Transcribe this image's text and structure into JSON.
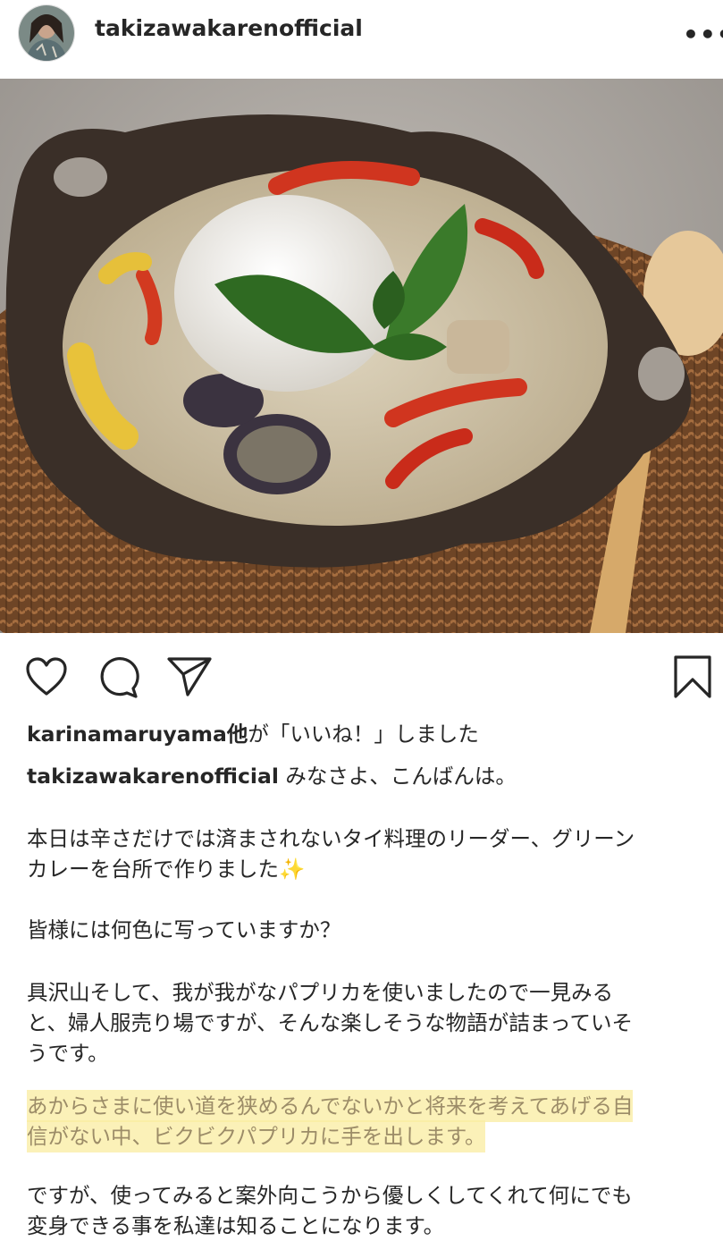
{
  "header": {
    "username": "takizawakarenofficial",
    "more_icon": "ellipsis-icon",
    "more_label": "•••"
  },
  "photo": {
    "subject": "green-curry-photo"
  },
  "actions": {
    "like_icon": "heart-icon",
    "comment_icon": "comment-icon",
    "share_icon": "send-icon",
    "save_icon": "bookmark-icon"
  },
  "likes": {
    "user": "karinamaruyama",
    "suffix_bold": "他",
    "suffix": "が「いいね！」しました"
  },
  "caption": {
    "author": "takizawakarenofficial",
    "greeting": "みなさよ、こんばんは。",
    "p1_line1": "本日は辛さだけでは済まされないタイ料理のリーダー、グリーン",
    "p1_line2": "カレーを台所で作りました",
    "p1_emoji": "✨",
    "p2": "皆様には何色に写っていますか？",
    "p3_line1": "具沢山そして、我が我がなパプリカを使いましたので一見みる",
    "p3_line2": "と、婦人服売り場ですが、そんな楽しそうな物語が詰まっていそ",
    "p3_line3": "うです。",
    "p4_line1": "あからさまに使い道を狭めるんでないかと将来を考えてあげる自",
    "p4_line2": "信がない中、ビクビクパプリカに手を出します。",
    "p5_line1": "ですが、使ってみると案外向こうから優しくしてくれて何にでも",
    "p5_line2": "変身できる事を私達は知ることになります。"
  },
  "colors": {
    "text": "#262626",
    "highlight": "#faeca0",
    "highlight_text": "#9c8c68"
  }
}
